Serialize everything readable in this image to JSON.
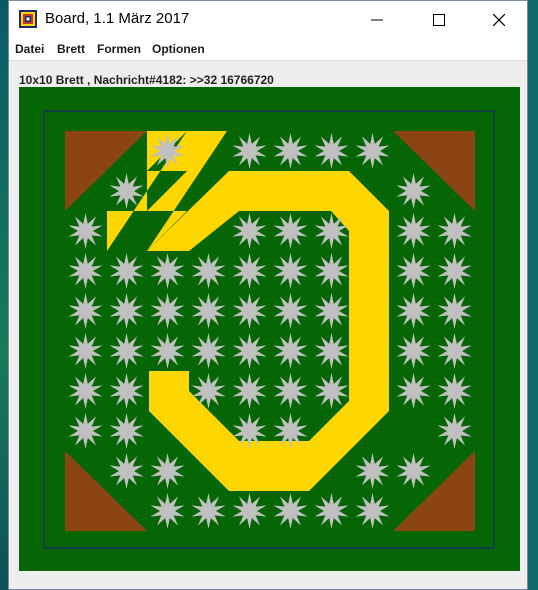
{
  "window": {
    "title": "Board, 1.1 März 2017",
    "minimize_icon": "minimize-icon",
    "maximize_icon": "maximize-icon",
    "close_icon": "close-icon",
    "app_icon": "board-grid-icon"
  },
  "menu": {
    "items": [
      "Datei",
      "Brett",
      "Formen",
      "Optionen"
    ]
  },
  "status": {
    "text": "10x10 Brett , Nachricht#4182: >>32 16766720"
  },
  "board": {
    "size": 10,
    "colors": {
      "field": "#066606",
      "star": "#c0c0c0",
      "corner": "#8b4513",
      "shape": "#ffd700",
      "frame": "#1c1c7a"
    },
    "star_cells": [
      [
        2,
        0
      ],
      [
        4,
        0
      ],
      [
        5,
        0
      ],
      [
        6,
        0
      ],
      [
        7,
        0
      ],
      [
        1,
        1
      ],
      [
        8,
        1
      ],
      [
        0,
        2
      ],
      [
        4,
        2
      ],
      [
        5,
        2
      ],
      [
        6,
        2
      ],
      [
        8,
        2
      ],
      [
        9,
        2
      ],
      [
        0,
        3
      ],
      [
        1,
        3
      ],
      [
        2,
        3
      ],
      [
        3,
        3
      ],
      [
        4,
        3
      ],
      [
        5,
        3
      ],
      [
        6,
        3
      ],
      [
        8,
        3
      ],
      [
        9,
        3
      ],
      [
        0,
        4
      ],
      [
        1,
        4
      ],
      [
        2,
        4
      ],
      [
        3,
        4
      ],
      [
        4,
        4
      ],
      [
        5,
        4
      ],
      [
        6,
        4
      ],
      [
        8,
        4
      ],
      [
        9,
        4
      ],
      [
        0,
        5
      ],
      [
        1,
        5
      ],
      [
        2,
        5
      ],
      [
        3,
        5
      ],
      [
        4,
        5
      ],
      [
        5,
        5
      ],
      [
        6,
        5
      ],
      [
        8,
        5
      ],
      [
        9,
        5
      ],
      [
        0,
        6
      ],
      [
        1,
        6
      ],
      [
        3,
        6
      ],
      [
        4,
        6
      ],
      [
        5,
        6
      ],
      [
        6,
        6
      ],
      [
        8,
        6
      ],
      [
        9,
        6
      ],
      [
        0,
        7
      ],
      [
        1,
        7
      ],
      [
        4,
        7
      ],
      [
        5,
        7
      ],
      [
        9,
        7
      ],
      [
        1,
        8
      ],
      [
        2,
        8
      ],
      [
        7,
        8
      ],
      [
        8,
        8
      ],
      [
        2,
        9
      ],
      [
        3,
        9
      ],
      [
        4,
        9
      ],
      [
        5,
        9
      ],
      [
        6,
        9
      ],
      [
        7,
        9
      ]
    ],
    "corner_cells": [
      "top-left",
      "top-right",
      "bottom-left",
      "bottom-right"
    ]
  }
}
